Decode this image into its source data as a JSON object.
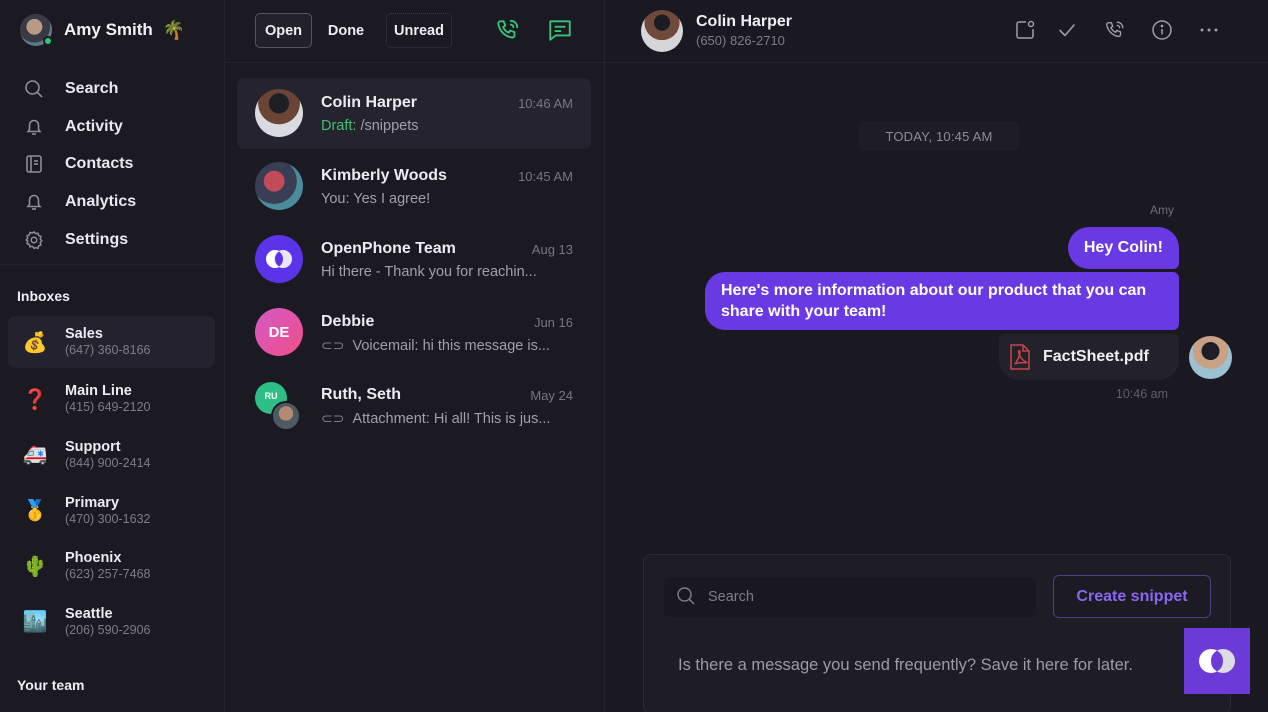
{
  "user": {
    "name": "Amy Smith",
    "status_emoji": "🌴",
    "status": "online"
  },
  "nav": [
    {
      "label": "Search",
      "icon": "search-icon"
    },
    {
      "label": "Activity",
      "icon": "bell-icon"
    },
    {
      "label": "Contacts",
      "icon": "contacts-book-icon"
    },
    {
      "label": "Analytics",
      "icon": "bell-icon"
    },
    {
      "label": "Settings",
      "icon": "gear-icon"
    }
  ],
  "inboxes": {
    "title": "Inboxes",
    "items": [
      {
        "name": "Sales",
        "phone": "(647) 360-8166",
        "emoji": "💰"
      },
      {
        "name": "Main Line",
        "phone": "(415) 649-2120",
        "emoji": "❓"
      },
      {
        "name": "Support",
        "phone": "(844) 900-2414",
        "emoji": "🚑"
      },
      {
        "name": "Primary",
        "phone": "(470) 300-1632",
        "emoji": "🥇"
      },
      {
        "name": "Phoenix",
        "phone": "(623) 257-7468",
        "emoji": "🌵"
      },
      {
        "name": "Seattle",
        "phone": "(206) 590-2906",
        "emoji": "🏙️"
      }
    ]
  },
  "team": {
    "title": "Your team"
  },
  "conversations": {
    "tabs": [
      {
        "label": "Open"
      },
      {
        "label": "Done"
      },
      {
        "label": "Unread"
      }
    ],
    "items": [
      {
        "name": "Colin Harper",
        "time": "10:46 AM",
        "draft_label": "Draft:",
        "preview": "/snippets"
      },
      {
        "name": "Kimberly Woods",
        "time": "10:45 AM",
        "preview": "You: Yes I agree!"
      },
      {
        "name": "OpenPhone Team",
        "time": "Aug 13",
        "preview": "Hi there - Thank you for reachin..."
      },
      {
        "name": "Debbie",
        "initials": "DE",
        "time": "Jun 16",
        "preview": "Voicemail: hi this message is..."
      },
      {
        "name": "Ruth, Seth",
        "initials": "RU",
        "time": "May 24",
        "preview": "Attachment: Hi all! This is jus..."
      }
    ]
  },
  "chat": {
    "contact_name": "Colin Harper",
    "contact_phone": "(650) 826-2710",
    "date_divider": "TODAY, 10:45 AM",
    "sender": "Amy",
    "messages": [
      {
        "text": "Hey Colin!"
      },
      {
        "text": "Here's more information about our product that you can share with your team!"
      }
    ],
    "attachment": {
      "filename": "FactSheet.pdf"
    },
    "time": "10:46 am"
  },
  "snippets": {
    "search_placeholder": "Search",
    "search_value": "",
    "create_label": "Create snippet",
    "hint": "Is there a message you send frequently? Save it here for later."
  },
  "colors": {
    "accent": "#6939e3",
    "green": "#3ac47a",
    "background": "#1a1921"
  }
}
